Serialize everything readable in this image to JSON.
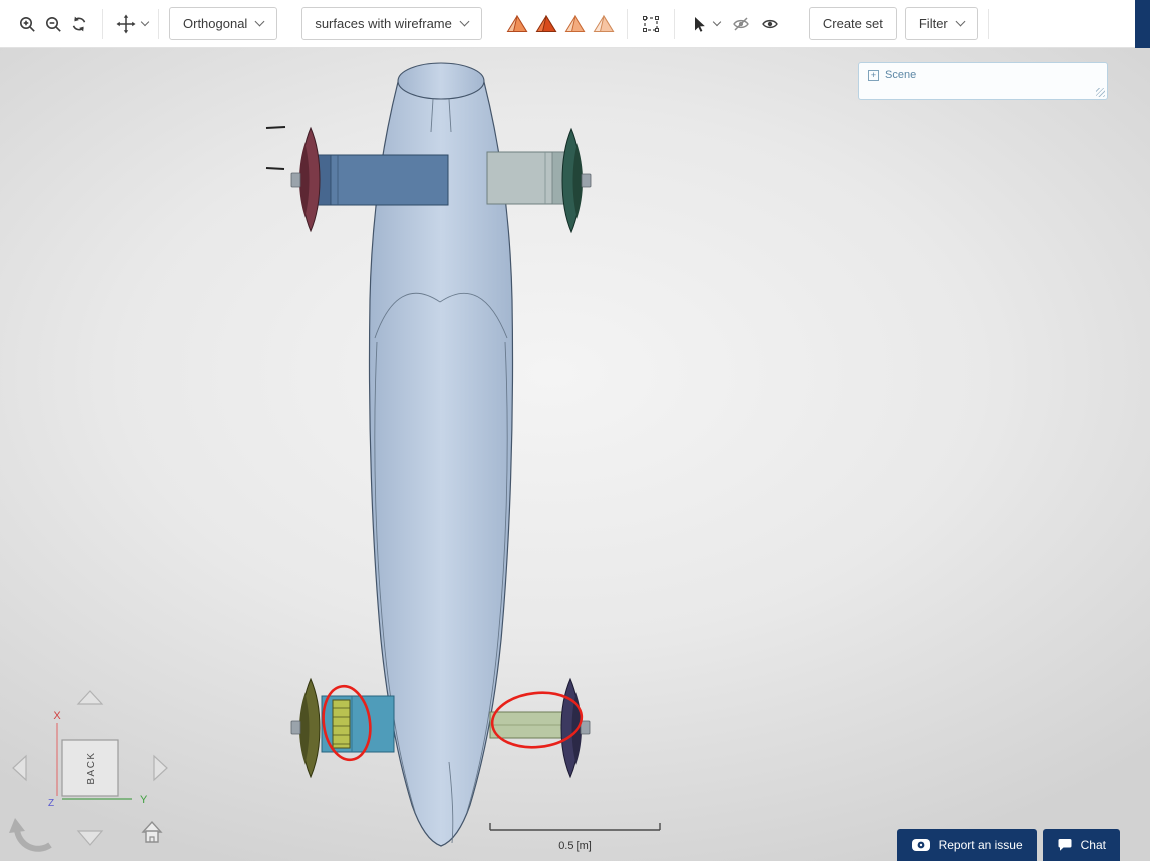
{
  "toolbar": {
    "projection_dropdown": "Orthogonal",
    "render_mode_dropdown": "surfaces with wireframe",
    "create_set_button": "Create set",
    "filter_dropdown": "Filter"
  },
  "scene_panel": {
    "title": "Scene",
    "expand_icon": "+"
  },
  "viewport": {
    "scale_bar_label": "0.5 [m]",
    "nav_back_label": "BACK",
    "axis_x": "X",
    "axis_y": "Y",
    "axis_z": "Z"
  },
  "footer": {
    "report_issue_label": "Report an issue",
    "chat_label": "Chat"
  },
  "colors": {
    "accent_navy": "#14386b",
    "annotation_red": "#e8211a",
    "hull": "#b9c8dd",
    "pylon_front_left": "#5b7da4",
    "pylon_front_right": "#b7c2c2",
    "pylon_rear_left": "#4f9cba",
    "pylon_rear_right": "#b9c8a4",
    "disc_front_left": "#7c3a48",
    "disc_front_right": "#2f5c50",
    "disc_rear_left": "#66682e",
    "disc_rear_right": "#3c3960",
    "stripe_block": "#b9c251"
  }
}
